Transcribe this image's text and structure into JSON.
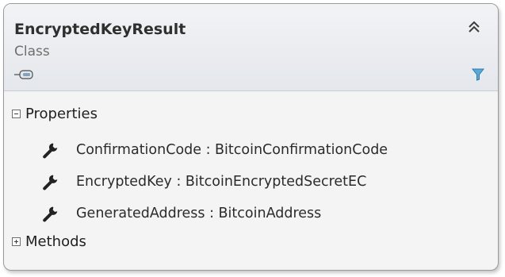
{
  "class": {
    "name": "EncryptedKeyResult",
    "kind": "Class"
  },
  "icons": {
    "collapse": "double-chevron-up-icon",
    "filter": "filter-icon",
    "type": "plug-icon",
    "property": "wrench-icon"
  },
  "sections": {
    "properties": {
      "label": "Properties",
      "expanded": true,
      "items": [
        {
          "name": "ConfirmationCode",
          "type": "BitcoinConfirmationCode",
          "label": "ConfirmationCode : BitcoinConfirmationCode"
        },
        {
          "name": "EncryptedKey",
          "type": "BitcoinEncryptedSecretEC",
          "label": "EncryptedKey : BitcoinEncryptedSecretEC"
        },
        {
          "name": "GeneratedAddress",
          "type": "BitcoinAddress",
          "label": "GeneratedAddress : BitcoinAddress"
        }
      ]
    },
    "methods": {
      "label": "Methods",
      "expanded": false
    }
  },
  "colors": {
    "filter": "#5aa9d6",
    "text": "#2b2b2b"
  }
}
